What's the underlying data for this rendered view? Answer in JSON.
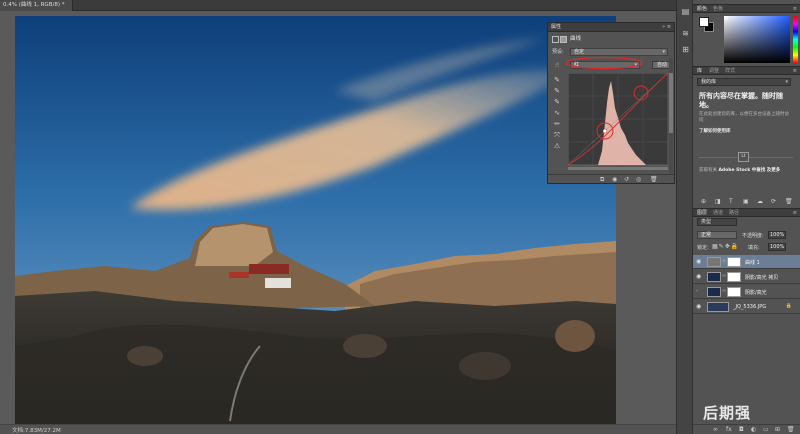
{
  "document": {
    "tab_title": "0.4% (曲线 1, RGB/8) *",
    "status": "文档:7.83M/27.2M"
  },
  "properties": {
    "panel_tab": "属性",
    "adjustment_name": "曲线",
    "preset_label": "预设:",
    "preset_value": "自定",
    "channel_value": "红",
    "auto_label": "自动"
  },
  "color_panel": {
    "tab_color": "颜色",
    "tab_swatches": "色板",
    "foreground": "#ffffff",
    "background": "#000000"
  },
  "libraries_panel": {
    "tab_libraries": "库",
    "tab_adjustments": "调整",
    "tab_styles": "样式",
    "library_select": "我的库",
    "headline": "所有内容尽在掌握。随时随地。",
    "description": "在此处创建您的库，以便在多台设备上随时访问",
    "learn_link": "了解如何使用库",
    "cc_label": "Lt",
    "stock_text": "获取有关",
    "stock_link": "Adobe Stock 中查找",
    "stock_text2": "及更多"
  },
  "layers_panel": {
    "tab_layers": "图层",
    "tab_channels": "通道",
    "tab_paths": "路径",
    "filter_label": "类型",
    "blend_mode": "正常",
    "opacity_label": "不透明度:",
    "opacity_value": "100%",
    "lock_label": "锁定:",
    "fill_label": "填充:",
    "fill_value": "100%",
    "layers": [
      {
        "name": "曲线 1",
        "selected": true
      },
      {
        "name": "阴影/高光 拷贝",
        "selected": false
      },
      {
        "name": "阴影/高光",
        "selected": false
      },
      {
        "name": "_JQ_5336.JPG",
        "selected": false
      }
    ]
  },
  "watermark": "后期强"
}
